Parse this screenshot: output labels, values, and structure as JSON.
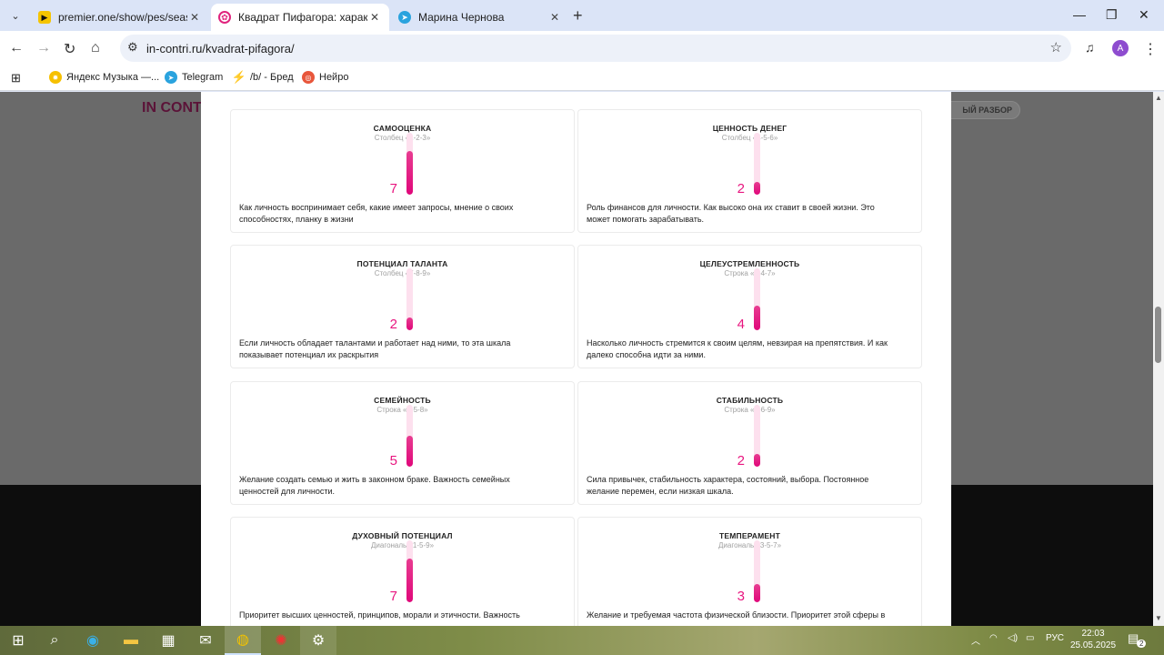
{
  "browser": {
    "tabs": [
      {
        "title": "premier.one/show/pes/season/",
        "favicon": "premier"
      },
      {
        "title": "Квадрат Пифагора: характер, с",
        "favicon": "incontri"
      },
      {
        "title": "Марина Чернова",
        "favicon": "telegram"
      }
    ],
    "url": "in-contri.ru/kvadrat-pifagora/",
    "profile_initial": "A",
    "bookmarks": [
      {
        "label": "Яндекс Музыка —..."
      },
      {
        "label": "Telegram"
      },
      {
        "label": "/b/ - Бред"
      },
      {
        "label": "Нейро"
      }
    ]
  },
  "background": {
    "logo": "IN CONT",
    "pill": "ЫЙ РАЗБОР"
  },
  "cards": [
    {
      "title": "САМООЦЕНКА",
      "subtitle": "Столбец «1-2-3»",
      "value": "7",
      "level": 0.7,
      "description": "Как личность воспринимает себя, какие имеет запросы, мнение о своих способностях, планку в жизни"
    },
    {
      "title": "ЦЕННОСТЬ ДЕНЕГ",
      "subtitle": "Столбец «4-5-6»",
      "value": "2",
      "level": 0.2,
      "description": "Роль финансов для личности. Как высоко она их ставит в своей жизни. Это может помогать зарабатывать."
    },
    {
      "title": "ПОТЕНЦИАЛ ТАЛАНТА",
      "subtitle": "Столбец «7-8-9»",
      "value": "2",
      "level": 0.2,
      "description": "Если личность обладает талантами и работает над ними, то эта шкала показывает потенциал их раскрытия"
    },
    {
      "title": "ЦЕЛЕУСТРЕМЛЕННОСТЬ",
      "subtitle": "Строка «1-4-7»",
      "value": "4",
      "level": 0.4,
      "description": "Насколько личность стремится к своим целям, невзирая на препятствия. И как далеко способна идти за ними."
    },
    {
      "title": "СЕМЕЙНОСТЬ",
      "subtitle": "Строка «2-5-8»",
      "value": "5",
      "level": 0.5,
      "description": "Желание создать семью и жить в законном браке. Важность семейных ценностей для личности."
    },
    {
      "title": "СТАБИЛЬНОСТЬ",
      "subtitle": "Строка «3-6-9»",
      "value": "2",
      "level": 0.2,
      "description": "Сила привычек, стабильность характера, состояний, выбора. Постоянное желание перемен, если низкая шкала."
    },
    {
      "title": "ДУХОВНЫЙ ПОТЕНЦИАЛ",
      "subtitle": "Диагональ «1-5-9»",
      "value": "7",
      "level": 0.7,
      "description": "Приоритет высших ценностей, принципов, морали и этичности. Важность"
    },
    {
      "title": "ТЕМПЕРАМЕНТ",
      "subtitle": "Диагональ «3-5-7»",
      "value": "3",
      "level": 0.3,
      "description": "Желание и требуемая частота физической близости. Приоритет этой сферы в"
    }
  ],
  "taskbar": {
    "lang": "РУС",
    "time": "22:03",
    "date": "25.05.2025",
    "notifications": "2"
  }
}
